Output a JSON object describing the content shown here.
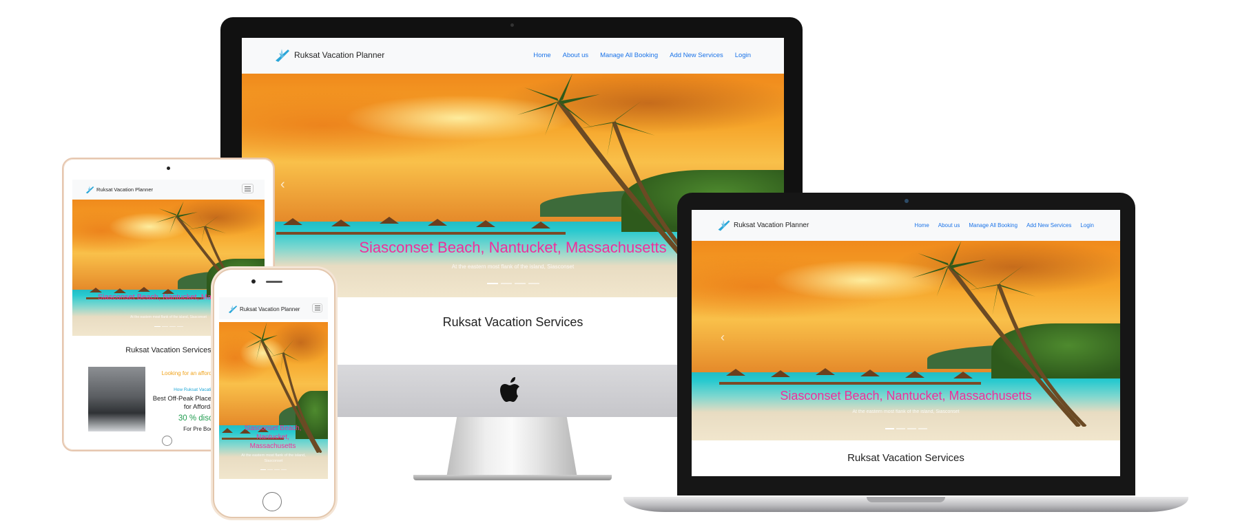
{
  "site": {
    "brand": "Ruksat Vacation Planner",
    "nav_links": [
      "Home",
      "About us",
      "Manage All Booking",
      "Add New Services",
      "Login"
    ],
    "hero_title": "Siasconset Beach, Nantucket, Massachusetts",
    "hero_subtitle": "At the eastern most flank of the island, Siasconset",
    "section_title": "Ruksat Vacation Services",
    "card": {
      "headline": "Looking for an affordable escape?",
      "link": "How Ruksat Vacation Planner",
      "title": "Best Off-Peak Places in December for Affordable",
      "discount": "30 % discount",
      "note": "For Pre Booking"
    }
  },
  "colors": {
    "nav_link": "#1a73e8",
    "hero_title": "#ee2f9b",
    "card_headline": "#f0a31c",
    "card_link": "#1fa6d6",
    "discount": "#1f9b4e"
  },
  "icons": [
    "plane-logo-icon",
    "hamburger-menu-icon",
    "apple-logo-icon",
    "carousel-prev-icon"
  ]
}
